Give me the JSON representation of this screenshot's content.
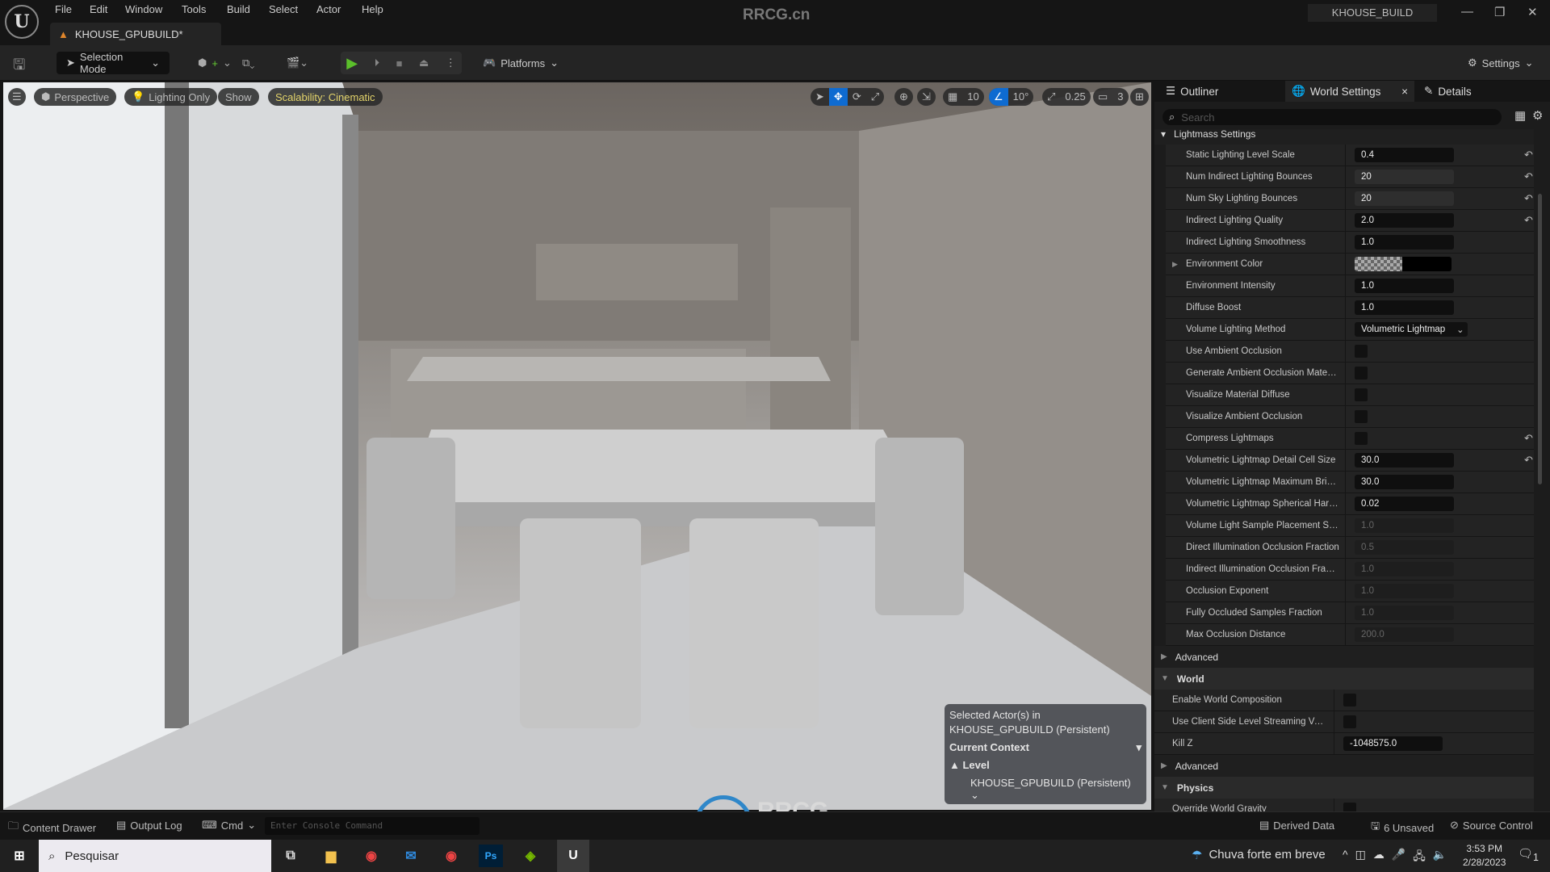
{
  "titlebar": {
    "menu": [
      "File",
      "Edit",
      "Window",
      "Tools",
      "Build",
      "Select",
      "Actor",
      "Help"
    ],
    "document_tab": "KHOUSE_GPUBUILD*",
    "watermark": "RRCG.cn",
    "project": "KHOUSE_BUILD"
  },
  "toolbar": {
    "selection_mode": "Selection Mode",
    "platforms": "Platforms",
    "settings": "Settings"
  },
  "viewport": {
    "menu_icon": "hamburger-icon",
    "perspective": "Perspective",
    "view_mode": "Lighting Only",
    "show": "Show",
    "scalability": "Scalability: Cinematic",
    "grid_snap": "10",
    "rotation_snap": "10°",
    "scale_snap": "0.25",
    "camera_speed": "3",
    "context": {
      "selected_line1": "Selected Actor(s) in",
      "selected_line2": "KHOUSE_GPUBUILD (Persistent)",
      "current_context": "Current Context",
      "level": "Level",
      "level_value": "KHOUSE_GPUBUILD (Persistent)"
    }
  },
  "panel": {
    "tabs": {
      "outliner": "Outliner",
      "world_settings": "World Settings",
      "details": "Details"
    },
    "search_placeholder": "Search",
    "lightmass_header": "Lightmass Settings",
    "rows": [
      {
        "label": "Static Lighting Level Scale",
        "value": "0.4",
        "reset": true,
        "kind": "text"
      },
      {
        "label": "Num Indirect Lighting Bounces",
        "value": "20",
        "reset": true,
        "kind": "num"
      },
      {
        "label": "Num Sky Lighting Bounces",
        "value": "20",
        "reset": true,
        "kind": "num"
      },
      {
        "label": "Indirect Lighting Quality",
        "value": "2.0",
        "reset": true,
        "kind": "text"
      },
      {
        "label": "Indirect Lighting Smoothness",
        "value": "1.0",
        "kind": "text"
      },
      {
        "label": "Environment Color",
        "kind": "color"
      },
      {
        "label": "Environment Intensity",
        "value": "1.0",
        "kind": "text"
      },
      {
        "label": "Diffuse Boost",
        "value": "1.0",
        "kind": "text"
      },
      {
        "label": "Volume Lighting Method",
        "value": "Volumetric Lightmap",
        "kind": "select"
      },
      {
        "label": "Use Ambient Occlusion",
        "kind": "check"
      },
      {
        "label": "Generate Ambient Occlusion Material...",
        "kind": "check"
      },
      {
        "label": "Visualize Material Diffuse",
        "kind": "check"
      },
      {
        "label": "Visualize Ambient Occlusion",
        "kind": "check"
      },
      {
        "label": "Compress Lightmaps",
        "kind": "check",
        "reset": true
      },
      {
        "label": "Volumetric Lightmap Detail Cell Size",
        "value": "30.0",
        "reset": true,
        "kind": "text"
      },
      {
        "label": "Volumetric Lightmap Maximum Brick...",
        "value": "30.0",
        "kind": "text"
      },
      {
        "label": "Volumetric Lightmap Spherical Harm...",
        "value": "0.02",
        "kind": "text"
      },
      {
        "label": "Volume Light Sample Placement Scale",
        "value": "1.0",
        "kind": "dim"
      },
      {
        "label": "Direct Illumination Occlusion Fraction",
        "value": "0.5",
        "kind": "dim"
      },
      {
        "label": "Indirect Illumination Occlusion Fracti...",
        "value": "1.0",
        "kind": "dim"
      },
      {
        "label": "Occlusion Exponent",
        "value": "1.0",
        "kind": "dim"
      },
      {
        "label": "Fully Occluded Samples Fraction",
        "value": "1.0",
        "kind": "dim"
      },
      {
        "label": "Max Occlusion Distance",
        "value": "200.0",
        "kind": "dim"
      }
    ],
    "advanced": "Advanced",
    "world": "World",
    "world_rows": [
      {
        "label": "Enable World Composition",
        "kind": "check"
      },
      {
        "label": "Use Client Side Level Streaming Volumes",
        "kind": "check"
      },
      {
        "label": "Kill Z",
        "value": "-1048575.0",
        "kind": "text"
      }
    ],
    "advanced2": "Advanced",
    "physics": "Physics",
    "physics_rows": [
      {
        "label": "Override World Gravity",
        "kind": "check"
      }
    ]
  },
  "statusbar": {
    "content_drawer": "Content Drawer",
    "output_log": "Output Log",
    "cmd": "Cmd",
    "console_placeholder": "Enter Console Command",
    "derived_data": "Derived Data",
    "unsaved": "6 Unsaved",
    "source_control": "Source Control"
  },
  "taskbar": {
    "search": "Pesquisar",
    "weather": "Chuva forte em breve",
    "time": "3:53 PM",
    "date": "2/28/2023",
    "notifications": "1"
  },
  "overlay_logo": "RRCG 人人素材"
}
